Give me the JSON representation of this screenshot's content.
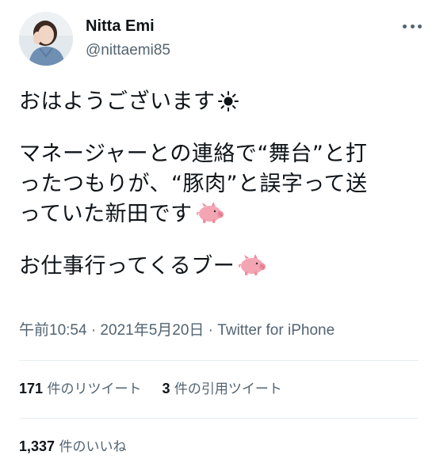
{
  "tweet": {
    "author": {
      "display_name": "Nitta Emi",
      "handle": "@nittaemi85",
      "avatar": "profile-photo"
    },
    "more_icon": "more-horizontal-icon",
    "lines": [
      "おはようございます",
      "マネージャーとの連絡で“舞台”と打",
      "ったつもりが、“豚肉”と誤字って送",
      "っていた新田です",
      "お仕事行ってくるブー"
    ],
    "emojis": [
      "sun-emoji",
      "pig-emoji",
      "pig-emoji"
    ],
    "timestamp": "午前10:54 · 2021年5月20日 · ",
    "source": "Twitter for iPhone",
    "stats": {
      "retweets": {
        "count": "171",
        "label": " 件のリツイート"
      },
      "quotes": {
        "count": "3",
        "label": " 件の引用ツイート"
      },
      "likes": {
        "count": "1,337",
        "label": " 件のいいね"
      }
    }
  }
}
